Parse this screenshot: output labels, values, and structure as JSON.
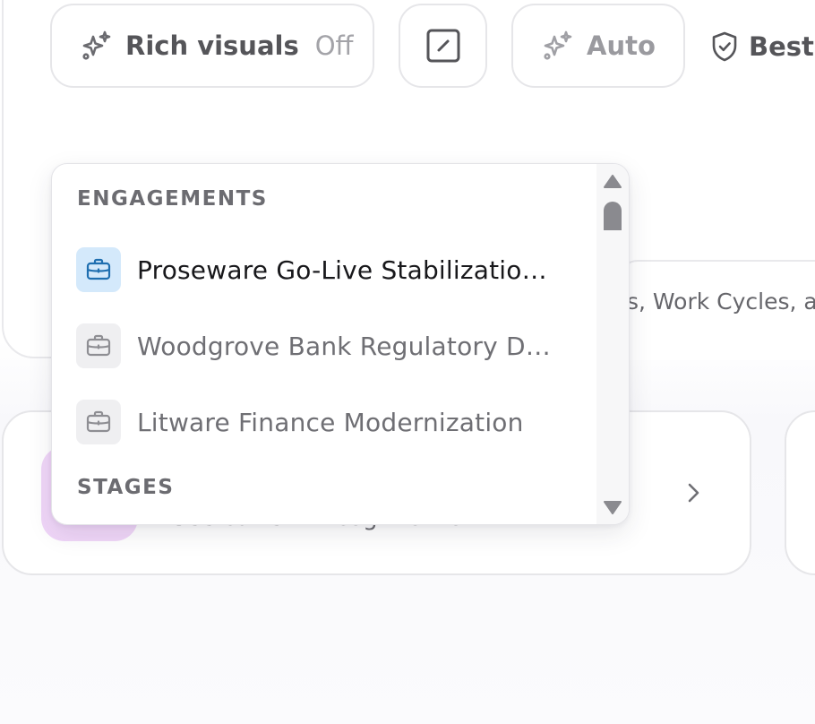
{
  "toolbar": {
    "rich_visuals_label": "Rich visuals",
    "rich_visuals_value": "Off",
    "auto_label": "Auto",
    "best_label": "Best"
  },
  "composer": {
    "subtitle_fragment": "s, Work Cycles, ar"
  },
  "action_card": {
    "subtitle": "See current Incognito work"
  },
  "dropdown": {
    "section_engagements": "ENGAGEMENTS",
    "engagements": [
      {
        "label": "Proseware Go-Live Stabilizatio…",
        "selected": true,
        "icon": "briefcase-icon"
      },
      {
        "label": "Woodgrove Bank Regulatory D…",
        "selected": false,
        "icon": "briefcase-icon"
      },
      {
        "label": "Litware Finance Modernization",
        "selected": false,
        "icon": "briefcase-icon"
      }
    ],
    "section_stages": "STAGES"
  },
  "colors": {
    "accent_blue": "#1f6fb0",
    "active_icon_bg": "#d4e9fb",
    "tile_purple": "#f0d6f8"
  }
}
